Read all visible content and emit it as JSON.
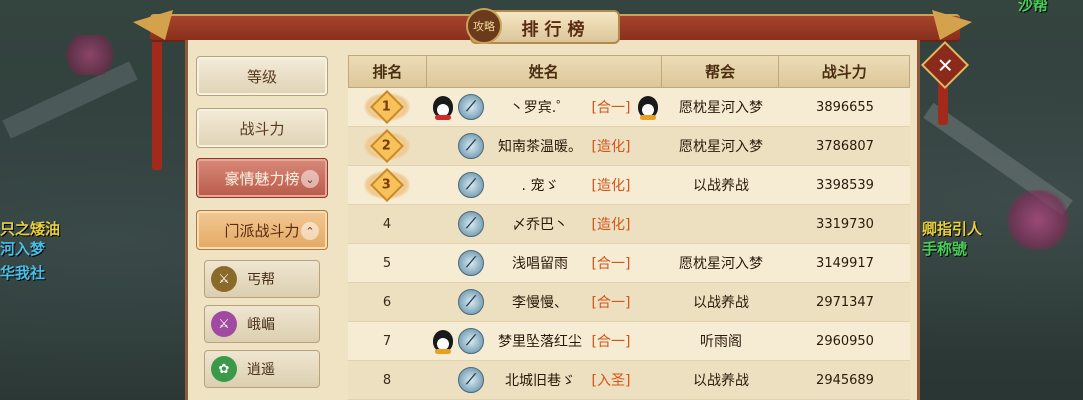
{
  "window": {
    "title": "排行榜",
    "badge": "攻略",
    "close_glyph": "✕"
  },
  "world_text": {
    "left_line1": "只之矮油",
    "left_line2": "河入梦",
    "left_line3": "华我社",
    "right_line1": "卿指引人",
    "right_line2": "手称號",
    "top_right": "沙帮"
  },
  "sidebar": {
    "items": [
      {
        "label": "等级",
        "state": "normal"
      },
      {
        "label": "战斗力",
        "state": "normal"
      },
      {
        "label": "豪情魅力榜",
        "state": "active",
        "arrow": "⌄"
      },
      {
        "label": "门派战斗力",
        "state": "open",
        "arrow": "⌃"
      }
    ],
    "sub_items": [
      {
        "label": "丐帮",
        "icon": "beggar-sect-icon",
        "color": "#8a6a2a"
      },
      {
        "label": "峨嵋",
        "icon": "emei-sect-icon",
        "color": "#a04aa0"
      },
      {
        "label": "逍遥",
        "icon": "xiaoyao-sect-icon",
        "color": "#3a9a4a"
      }
    ]
  },
  "table": {
    "headers": [
      "排名",
      "姓名",
      "帮会",
      "战斗力"
    ],
    "rows": [
      {
        "rank": "1",
        "medal": true,
        "qq": "red",
        "name": "丶罗宾.゜",
        "server": "[合一]",
        "guild": "愿枕星河入梦",
        "power": "3896655",
        "qq_tail": true
      },
      {
        "rank": "2",
        "medal": true,
        "qq": "",
        "name": "知南茶温暖。",
        "server": "[造化]",
        "guild": "愿枕星河入梦",
        "power": "3786807",
        "qq_tail": false
      },
      {
        "rank": "3",
        "medal": true,
        "qq": "",
        "name": ". 宠ゞ",
        "server": "[造化]",
        "guild": "以战养战",
        "power": "3398539",
        "qq_tail": false
      },
      {
        "rank": "4",
        "medal": false,
        "qq": "",
        "name": "〆乔巴丶",
        "server": "[造化]",
        "guild": "",
        "power": "3319730",
        "qq_tail": false
      },
      {
        "rank": "5",
        "medal": false,
        "qq": "",
        "name": "浅唱留雨",
        "server": "[合一]",
        "guild": "愿枕星河入梦",
        "power": "3149917",
        "qq_tail": false
      },
      {
        "rank": "6",
        "medal": false,
        "qq": "",
        "name": "李慢慢、",
        "server": "[合一]",
        "guild": "以战养战",
        "power": "2971347",
        "qq_tail": false
      },
      {
        "rank": "7",
        "medal": false,
        "qq": "yellow",
        "name": "梦里坠落红尘",
        "server": "[合一]",
        "guild": "听雨阁",
        "power": "2960950",
        "qq_tail": false
      },
      {
        "rank": "8",
        "medal": false,
        "qq": "",
        "name": "北城旧巷ゞ",
        "server": "[入圣]",
        "guild": "以战养战",
        "power": "2945689",
        "qq_tail": false
      }
    ]
  },
  "colors": {
    "accent_red": "#a5432b",
    "server_orange": "#d2551a",
    "panel_bg": "#efe3c4"
  }
}
